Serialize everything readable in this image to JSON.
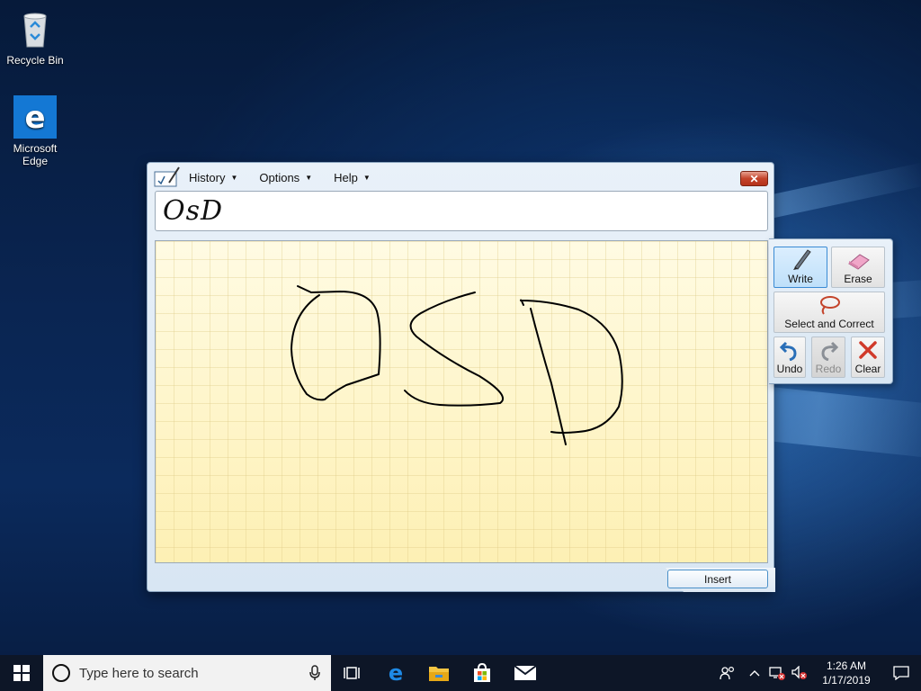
{
  "desktop": {
    "icons": [
      {
        "label": "Recycle Bin",
        "icon": "recycle-bin-icon"
      },
      {
        "label": "Microsoft Edge",
        "icon": "edge-icon"
      }
    ]
  },
  "input_panel": {
    "menu": [
      {
        "label": "History"
      },
      {
        "label": "Options"
      },
      {
        "label": "Help"
      }
    ],
    "close_icon": "close-icon",
    "recognized_text": "OsD",
    "insert_label": "Insert"
  },
  "tools": {
    "write": "Write",
    "erase": "Erase",
    "select_correct": "Select and Correct",
    "undo": "Undo",
    "redo": "Redo",
    "clear": "Clear"
  },
  "taskbar": {
    "search_placeholder": "Type here to search",
    "pinned": [
      "task-view-icon",
      "edge-icon",
      "file-explorer-icon",
      "store-icon",
      "mail-icon"
    ],
    "clock_time": "1:26 AM",
    "clock_date": "1/17/2019"
  },
  "colors": {
    "taskbar": "#0d1627",
    "accent": "#0078d7",
    "ink_background": "#fff8d2"
  }
}
